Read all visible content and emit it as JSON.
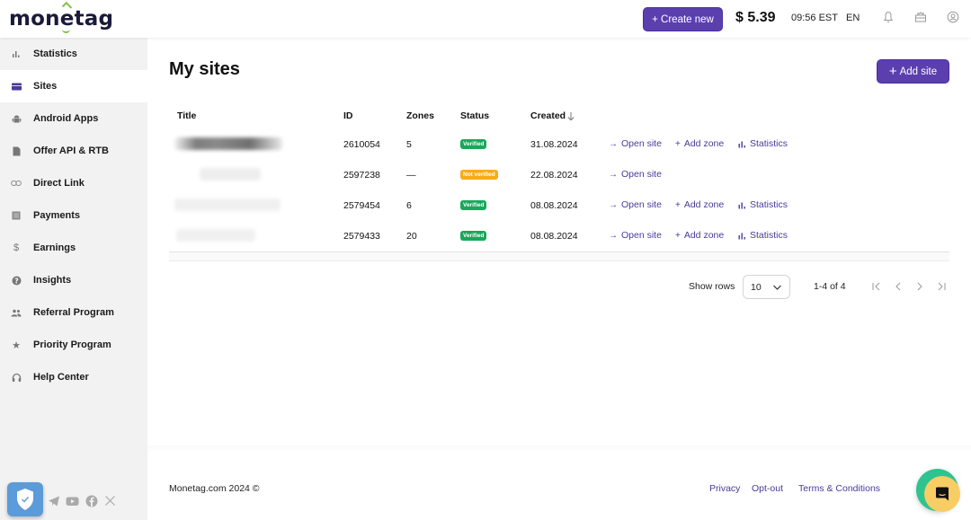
{
  "header": {
    "logo": "monetag",
    "create_new_label": "+ Create new",
    "balance": "$ 5.39",
    "time": "09:56 EST",
    "language": "EN",
    "icons": [
      "bell-icon",
      "gift-icon",
      "user-icon"
    ]
  },
  "sidebar": {
    "items": [
      {
        "label": "Statistics",
        "icon": "bar-chart-icon",
        "active": false
      },
      {
        "label": "Sites",
        "icon": "sites-icon",
        "active": true
      },
      {
        "label": "Android Apps",
        "icon": "android-icon",
        "active": false
      },
      {
        "label": "Offer API & RTB",
        "icon": "document-icon",
        "active": false
      },
      {
        "label": "Direct Link",
        "icon": "link-icon",
        "active": false
      },
      {
        "label": "Payments",
        "icon": "payments-icon",
        "active": false
      },
      {
        "label": "Earnings",
        "icon": "dollar-icon",
        "active": false
      },
      {
        "label": "Insights",
        "icon": "help-circle-icon",
        "active": false
      },
      {
        "label": "Referral Program",
        "icon": "people-icon",
        "active": false
      },
      {
        "label": "Priority Program",
        "icon": "star-icon",
        "active": false
      },
      {
        "label": "Help Center",
        "icon": "headset-icon",
        "active": false
      }
    ],
    "social": [
      "telegram-icon",
      "youtube-icon",
      "facebook-icon",
      "x-icon"
    ]
  },
  "main": {
    "title": "My sites",
    "add_site_label": "Add site",
    "table": {
      "columns": [
        "Title",
        "ID",
        "Zones",
        "Status",
        "Created"
      ],
      "sort_column": "Created",
      "rows": [
        {
          "title": "",
          "id": "2610054",
          "zones": "5",
          "status": "Verified",
          "created": "31.08.2024",
          "actions": [
            "Open site",
            "Add zone",
            "Statistics"
          ]
        },
        {
          "title": "",
          "id": "2597238",
          "zones": "—",
          "status": "Not verified",
          "created": "22.08.2024",
          "actions": [
            "Open site"
          ]
        },
        {
          "title": "",
          "id": "2579454",
          "zones": "6",
          "status": "Verified",
          "created": "08.08.2024",
          "actions": [
            "Open site",
            "Add zone",
            "Statistics"
          ]
        },
        {
          "title": "",
          "id": "2579433",
          "zones": "20",
          "status": "Verified",
          "created": "08.08.2024",
          "actions": [
            "Open site",
            "Add zone",
            "Statistics"
          ]
        }
      ]
    },
    "pagination": {
      "show_rows_label": "Show rows",
      "rows_per_page": "10",
      "range": "1-4 of 4"
    }
  },
  "footer": {
    "copyright": "Monetag.com 2024 ©",
    "links": [
      "Privacy",
      "Opt-out",
      "Terms & Conditions"
    ]
  },
  "colors": {
    "accent": "#5b3fae",
    "verified": "#17a85a",
    "not_verified": "#f6ac1a",
    "link": "#4a3a9a"
  }
}
